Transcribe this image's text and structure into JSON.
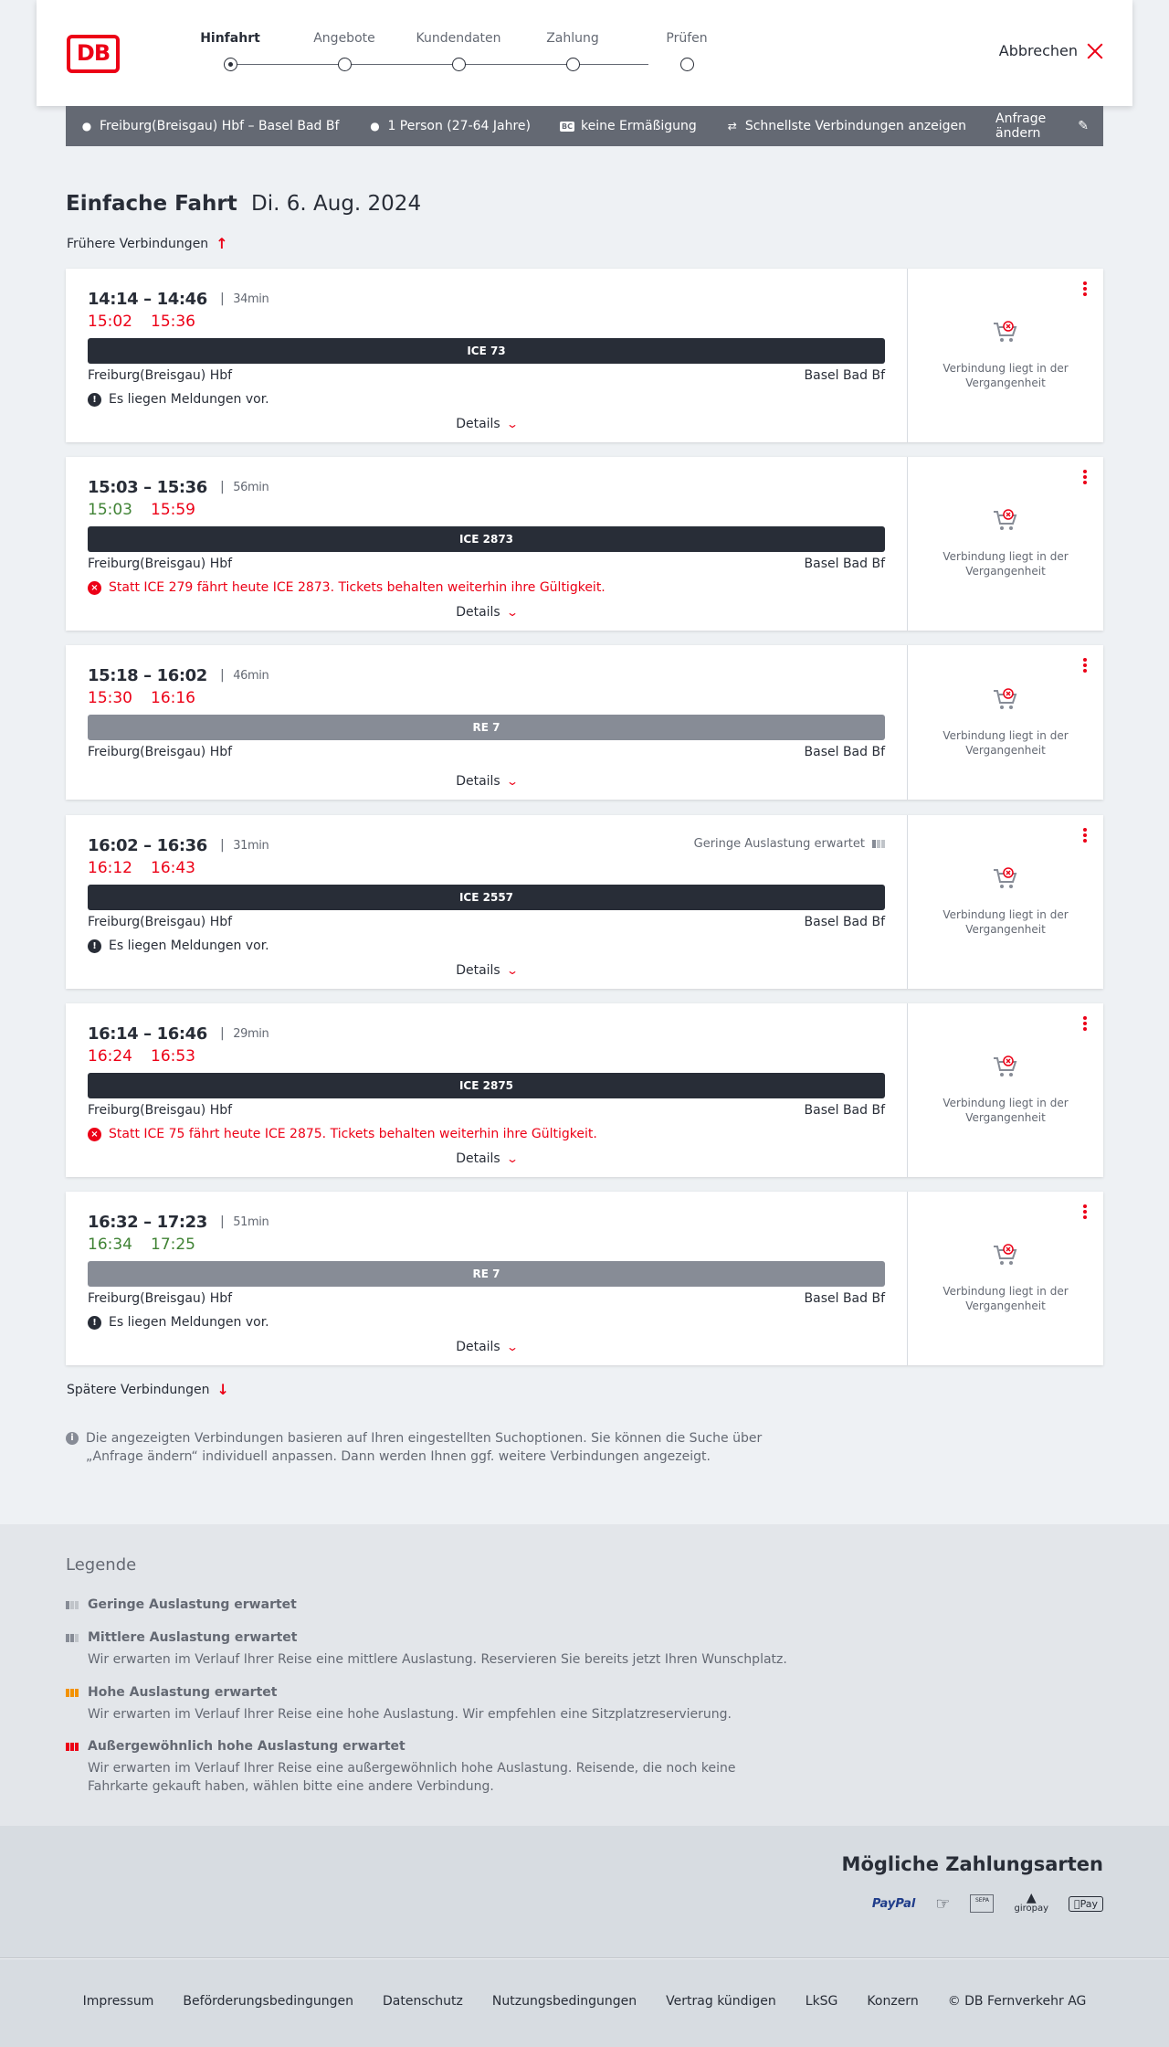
{
  "header": {
    "logo": "DB",
    "steps": [
      {
        "label": "Hinfahrt",
        "active": true
      },
      {
        "label": "Angebote",
        "active": false
      },
      {
        "label": "Kundendaten",
        "active": false
      },
      {
        "label": "Zahlung",
        "active": false
      },
      {
        "label": "Prüfen",
        "active": false
      }
    ],
    "cancel_label": "Abbrechen"
  },
  "query": {
    "route": "Freiburg(Breisgau) Hbf – Basel Bad Bf",
    "passengers": "1 Person (27-64 Jahre)",
    "discount_badge": "BC",
    "discount": "keine Ermäßigung",
    "fastest": "Schnellste Verbindungen anzeigen",
    "edit_label": "Anfrage ändern"
  },
  "trip": {
    "type": "Einfache Fahrt",
    "date": "Di. 6. Aug. 2024",
    "earlier_label": "Frühere Verbindungen",
    "later_label": "Spätere Verbindungen"
  },
  "common": {
    "details_label": "Details",
    "past_label": "Verbindung liegt in der Vergangenheit",
    "from": "Freiburg(Breisgau) Hbf",
    "to": "Basel Bad Bf"
  },
  "connections": [
    {
      "times": "14:14 – 14:46",
      "duration": "34min",
      "rt_dep": "15:02",
      "rt_dep_color": "red",
      "rt_arr": "15:36",
      "rt_arr_color": "red",
      "train": "ICE 73",
      "train_style": "dark",
      "load": "",
      "msg": "Es liegen Meldungen vor.",
      "msg_type": "info"
    },
    {
      "times": "15:03 – 15:36",
      "duration": "56min",
      "rt_dep": "15:03",
      "rt_dep_color": "green",
      "rt_arr": "15:59",
      "rt_arr_color": "red",
      "train": "ICE 2873",
      "train_style": "dark",
      "load": "",
      "msg": "Statt ICE 279 fährt heute ICE 2873. Tickets behalten weiterhin ihre Gültigkeit.",
      "msg_type": "error"
    },
    {
      "times": "15:18 – 16:02",
      "duration": "46min",
      "rt_dep": "15:30",
      "rt_dep_color": "red",
      "rt_arr": "16:16",
      "rt_arr_color": "red",
      "train": "RE 7",
      "train_style": "grey",
      "load": "",
      "msg": "",
      "msg_type": ""
    },
    {
      "times": "16:02 – 16:36",
      "duration": "31min",
      "rt_dep": "16:12",
      "rt_dep_color": "red",
      "rt_arr": "16:43",
      "rt_arr_color": "red",
      "train": "ICE 2557",
      "train_style": "dark",
      "load": "Geringe Auslastung erwartet",
      "msg": "Es liegen Meldungen vor.",
      "msg_type": "info"
    },
    {
      "times": "16:14 – 16:46",
      "duration": "29min",
      "rt_dep": "16:24",
      "rt_dep_color": "red",
      "rt_arr": "16:53",
      "rt_arr_color": "red",
      "train": "ICE 2875",
      "train_style": "dark",
      "load": "",
      "msg": "Statt ICE 75 fährt heute ICE 2875. Tickets behalten weiterhin ihre Gültigkeit.",
      "msg_type": "error"
    },
    {
      "times": "16:32 – 17:23",
      "duration": "51min",
      "rt_dep": "16:34",
      "rt_dep_color": "green",
      "rt_arr": "17:25",
      "rt_arr_color": "green",
      "train": "RE 7",
      "train_style": "grey",
      "load": "",
      "msg": "Es liegen Meldungen vor.",
      "msg_type": "info"
    }
  ],
  "info_text": "Die angezeigten Verbindungen basieren auf Ihren eingestellten Suchoptionen. Sie können die Suche über „Anfrage ändern“ individuell anpassen. Dann werden Ihnen ggf. weitere Verbindungen angezeigt.",
  "legend": {
    "title": "Legende",
    "items": [
      {
        "title": "Geringe Auslastung erwartet",
        "text": ""
      },
      {
        "title": "Mittlere Auslastung erwartet",
        "text": "Wir erwarten im Verlauf Ihrer Reise eine mittlere Auslastung. Reservieren Sie bereits jetzt Ihren Wunschplatz."
      },
      {
        "title": "Hohe Auslastung erwartet",
        "text": "Wir erwarten im Verlauf Ihrer Reise eine hohe Auslastung. Wir empfehlen eine Sitzplatzreservierung."
      },
      {
        "title": "Außergewöhnlich hohe Auslastung erwartet",
        "text": "Wir erwarten im Verlauf Ihrer Reise eine außergewöhnlich hohe Auslastung. Reisende, die noch keine Fahrkarte gekauft haben, wählen bitte eine andere Verbindung."
      }
    ]
  },
  "payment": {
    "title": "Mögliche Zahlungsarten",
    "paypal": "PayPal",
    "sepa": "SEPA",
    "giropay": "giropay",
    "applepay": "Pay"
  },
  "footer": {
    "links": [
      "Impressum",
      "Beförderungsbedingungen",
      "Datenschutz",
      "Nutzungsbedingungen",
      "Vertrag kündigen",
      "LkSG",
      "Konzern",
      "© DB Fernverkehr AG"
    ]
  },
  "colors": {
    "brand_red": "#ec0016",
    "on_time_green": "#408335",
    "dark": "#282d37",
    "grey": "#646973"
  }
}
